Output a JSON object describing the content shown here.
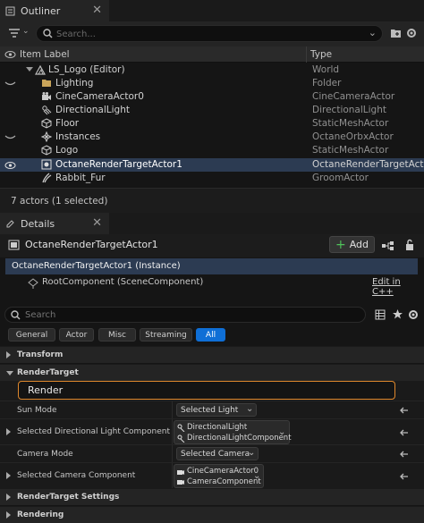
{
  "outliner": {
    "tab_label": "Outliner",
    "search_placeholder": "Search...",
    "col_item_label": "Item Label",
    "col_type": "Type",
    "rows": [
      {
        "label": "LS_Logo (Editor)",
        "type": "World",
        "icon": "world-icon"
      },
      {
        "label": "Lighting",
        "type": "Folder",
        "icon": "folder-icon"
      },
      {
        "label": "CineCameraActor0",
        "type": "CineCameraActor",
        "icon": "camera-icon"
      },
      {
        "label": "DirectionalLight",
        "type": "DirectionalLight",
        "icon": "light-icon"
      },
      {
        "label": "Floor",
        "type": "StaticMeshActor",
        "icon": "mesh-icon"
      },
      {
        "label": "Instances",
        "type": "OctaneOrbxActor",
        "icon": "orbx-icon"
      },
      {
        "label": "Logo",
        "type": "StaticMeshActor",
        "icon": "mesh-icon"
      },
      {
        "label": "OctaneRenderTargetActor1",
        "type": "OctaneRenderTargetActor",
        "icon": "actor-icon"
      },
      {
        "label": "Rabbit_Fur",
        "type": "GroomActor",
        "icon": "groom-icon"
      }
    ],
    "status": "7 actors (1 selected)"
  },
  "details": {
    "tab_label": "Details",
    "actor_name": "OctaneRenderTargetActor1",
    "add_label": "Add",
    "instance_label": "OctaneRenderTargetActor1 (Instance)",
    "root_component": "RootComponent (SceneComponent)",
    "edit_link": "Edit in C++",
    "search_placeholder": "Search",
    "filters": [
      "General",
      "Actor",
      "Misc",
      "Streaming",
      "All"
    ],
    "active_filter": "All",
    "sections": {
      "transform": "Transform",
      "render_target": "RenderTarget",
      "render_target_settings": "RenderTarget Settings",
      "rendering": "Rendering"
    },
    "render_input": "Render",
    "props": {
      "sun_mode_label": "Sun Mode",
      "sun_mode_value": "Selected Light",
      "dir_light_label": "Selected Directional Light Component",
      "dir_light_line1": "DirectionalLight",
      "dir_light_line2": "DirectionalLightComponent",
      "camera_mode_label": "Camera Mode",
      "camera_mode_value": "Selected Camera",
      "camera_comp_label": "Selected Camera Component",
      "camera_comp_line1": "CineCameraActor0",
      "camera_comp_line2": "CameraComponent"
    }
  },
  "colors": {
    "selection": "#2c3b52",
    "accent": "#0f6fd6",
    "highlight_border": "#e0882c"
  }
}
